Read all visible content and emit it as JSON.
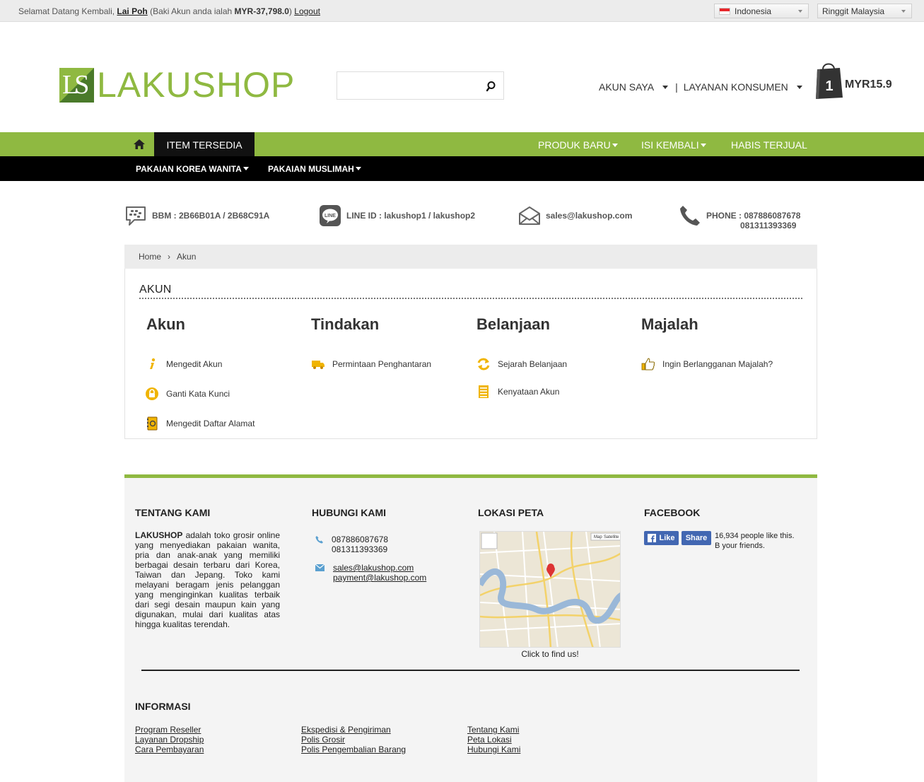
{
  "topbar": {
    "welcome_prefix": "Selamat Datang Kembali,",
    "username": "Lai Poh",
    "balance_prefix": "(Baki Akun anda ialah",
    "balance_value": "MYR-37,798.0",
    "balance_suffix": ")",
    "logout": "Logout",
    "language": "Indonesia",
    "currency": "Ringgit Malaysia"
  },
  "header": {
    "logo_mark": "LS",
    "logo_text": "LAKUSHOP",
    "search_placeholder": "",
    "account_menu": "AKUN SAYA",
    "separator": "|",
    "service_menu": "LAYANAN KONSUMEN",
    "cart_count": "1",
    "cart_total": "MYR15.9"
  },
  "nav": {
    "items_tab": "ITEM TERSEDIA",
    "new_products": "PRODUK BARU",
    "restock": "ISI KEMBALI",
    "sold_out": "HABIS TERJUAL",
    "korea": "PAKAIAN KOREA WANITA",
    "muslim": "PAKAIAN MUSLIMAH"
  },
  "contacts": {
    "bbm": "BBM : 2B66B01A / 2B68C91A",
    "line": "LINE ID : lakushop1 / lakushop2",
    "email": "sales@lakushop.com",
    "phone1": "PHONE : 087886087678",
    "phone2": "081311393369"
  },
  "breadcrumb": {
    "home": "Home",
    "arrow": "›",
    "current": "Akun"
  },
  "account_page": {
    "title": "AKUN",
    "columns": [
      {
        "heading": "Akun",
        "links": [
          "Mengedit Akun",
          "Ganti Kata Kunci",
          "Mengedit Daftar Alamat"
        ]
      },
      {
        "heading": "Tindakan",
        "links": [
          "Permintaan Penghantaran"
        ]
      },
      {
        "heading": "Belanjaan",
        "links": [
          "Sejarah Belanjaan",
          "Kenyataan Akun"
        ]
      },
      {
        "heading": "Majalah",
        "links": [
          "Ingin Berlangganan Majalah?"
        ]
      }
    ]
  },
  "icons": {
    "info": "info-icon",
    "lock": "lock-icon",
    "address_book": "address-book-icon",
    "truck": "truck-icon",
    "refresh": "refresh-icon",
    "statement": "statement-icon",
    "thumbs_up": "thumbs-up-icon"
  },
  "colors": {
    "brand_green": "#8fb941",
    "dark_green": "#4a7a2a",
    "nav_black": "#000000",
    "icon_yellow": "#f0b400",
    "facebook_blue": "#4267b2"
  },
  "footer": {
    "about": {
      "heading": "TENTANG KAMI",
      "brand": "LAKUSHOP",
      "text": " adalah toko grosir online yang menyediakan pakaian wanita, pria dan anak-anak yang memiliki berbagai desain terbaru dari Korea, Taiwan dan Jepang. Toko kami melayani beragam jenis pelanggan yang menginginkan kualitas terbaik dari segi desain maupun kain yang digunakan, mulai dari kualitas atas hingga kualitas terendah."
    },
    "contact": {
      "heading": "HUBUNGI KAMI",
      "phone1": "087886087678",
      "phone2": "081311393369",
      "email1": "sales@lakushop.com",
      "email2": "payment@lakushop.com"
    },
    "map": {
      "heading": "LOKASI PETA",
      "caption": "Click to find us!",
      "btn_map": "Map",
      "btn_satellite": "Satellite"
    },
    "facebook": {
      "heading": "FACEBOOK",
      "like": "Like",
      "share": "Share",
      "text": "16,934 people like this. B your friends."
    },
    "info": {
      "heading": "INFORMASI",
      "col1": [
        "Program Reseller",
        "Layanan Dropship",
        "Cara Pembayaran"
      ],
      "col2": [
        "Ekspedisi & Pengiriman",
        "Polis Grosir",
        "Polis Pengembalian Barang"
      ],
      "col3": [
        "Tentang Kami",
        "Peta Lokasi",
        "Hubungi Kami"
      ]
    }
  }
}
